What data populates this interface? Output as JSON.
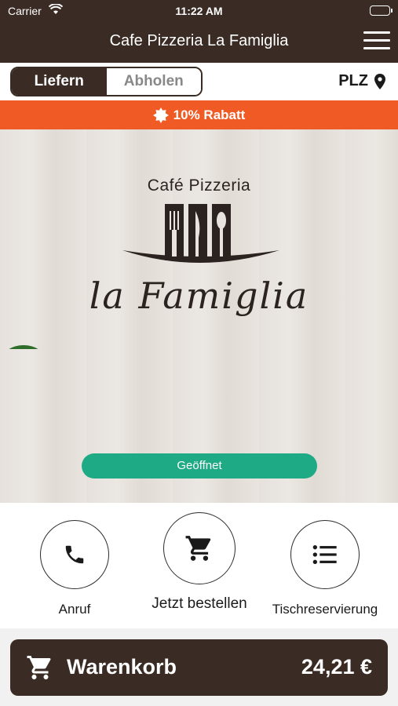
{
  "status_bar": {
    "carrier": "Carrier",
    "time": "11:22 AM"
  },
  "header": {
    "title": "Cafe Pizzeria La Famiglia"
  },
  "delivery_mode": {
    "options": [
      "Liefern",
      "Abholen"
    ],
    "selected": "Liefern",
    "postcode_label": "PLZ"
  },
  "promo": {
    "text": "10% Rabatt"
  },
  "hero": {
    "brand_top": "Café Pizzeria",
    "brand_main": "la Famiglia",
    "status": "Geöffnet"
  },
  "actions": [
    {
      "label": "Anruf",
      "icon": "phone-icon"
    },
    {
      "label": "Jetzt bestellen",
      "icon": "cart-icon"
    },
    {
      "label": "Tischreservierung",
      "icon": "list-icon"
    }
  ],
  "cart": {
    "label": "Warenkorb",
    "total": "24,21 €"
  },
  "colors": {
    "brand_dark": "#3a2b24",
    "promo": "#f05a24",
    "open": "#1eaa84"
  }
}
